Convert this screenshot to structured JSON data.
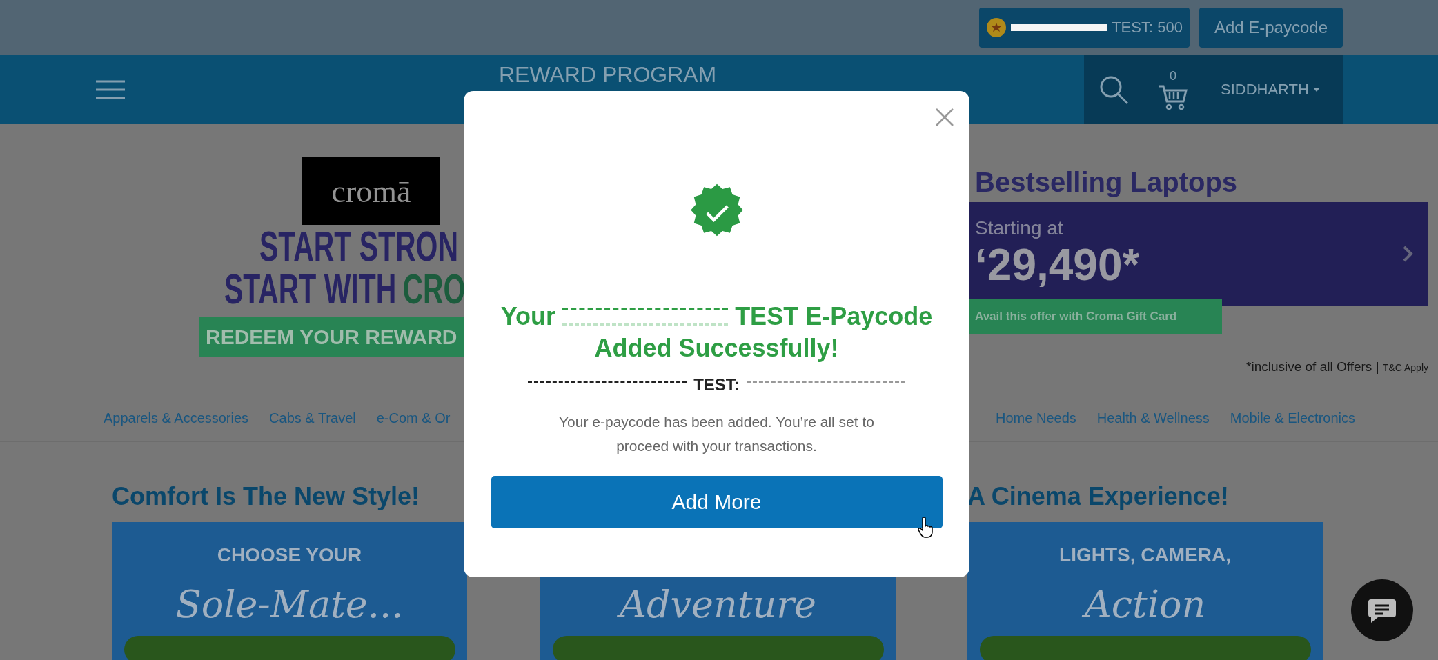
{
  "top_bar": {
    "points": {
      "redacted": true,
      "text": "TEST: 500"
    },
    "add_button": "Add E-paycode"
  },
  "nav": {
    "title": "REWARD PROGRAM",
    "cart_count": "0",
    "user": "SIDDHARTH"
  },
  "hero_left": {
    "logo": "cromā",
    "line_1": "START STRON",
    "line_2_start": "START WITH",
    "line_2_accent": "CRO",
    "redeem": "REDEEM YOUR REWARD"
  },
  "hero_right": {
    "title": "Bestselling Laptops",
    "starting": "Starting at",
    "price": "‘29,490*",
    "offer": "Avail this offer with Croma Gift Card",
    "note": "*inclusive of all Offers |",
    "terms": "T&C Apply"
  },
  "categories_left": [
    "Apparels & Accessories",
    "Cabs & Travel",
    "e-Com & Or"
  ],
  "categories_right": [
    "Home Needs",
    "Health & Wellness",
    "Mobile & Electronics"
  ],
  "sections": [
    {
      "title": "Comfort Is The New Style!",
      "caption": "CHOOSE YOUR",
      "script": "Sole-Mate..."
    },
    {
      "script": "Adventure"
    },
    {
      "title": "A Cinema Experience!",
      "caption": "LIGHTS, CAMERA,",
      "script": "Action"
    }
  ],
  "modal": {
    "heading": {
      "before": "Your",
      "redacted": true,
      "after": "TEST E-Paycode",
      "line_2": "Added Successfully!"
    },
    "code": {
      "prefix_redacted": true,
      "label": "TEST:",
      "value_redacted": true
    },
    "message": "Your e-paycode has been added. You’re all set to proceed with your transactions.",
    "button": "Add More"
  }
}
